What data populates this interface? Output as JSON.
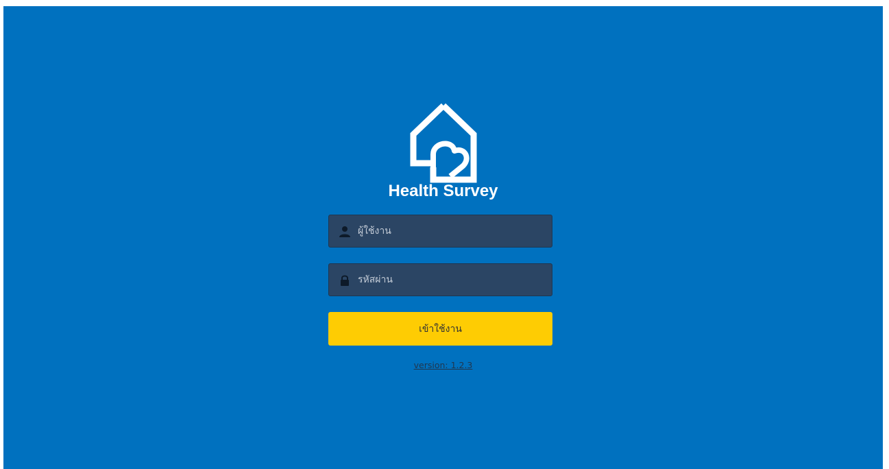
{
  "app": {
    "title": "Health Survey"
  },
  "login": {
    "username": {
      "icon": "user-icon",
      "placeholder": "ผู้ใช้งาน",
      "value": ""
    },
    "password": {
      "icon": "lock-icon",
      "placeholder": "รหัสผ่าน",
      "value": ""
    },
    "submit_label": "เข้าใช้งาน"
  },
  "footer": {
    "version_text": "version: 1.2.3"
  },
  "colors": {
    "background": "#0071bf",
    "field_bg": "#2b4564",
    "button_bg": "#fecc03",
    "title_text": "#ffffff"
  }
}
